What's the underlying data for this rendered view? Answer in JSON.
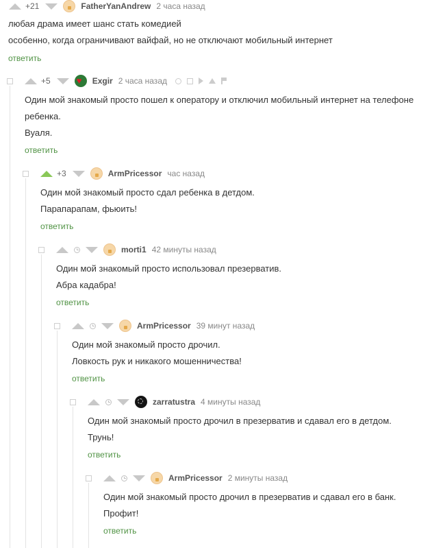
{
  "reply_label": "ответить",
  "comments": [
    {
      "score": "+21",
      "username": "FatherYanAndrew",
      "time": "2 часа назад",
      "avatar_icon": "doll-avatar",
      "lines": [
        "любая драма имеет шанс стать комедией",
        "особенно, когда ограничивают вайфай, но не отключают мобильный интернет"
      ]
    },
    {
      "score": "+5",
      "username": "Exgir",
      "time": "2 часа назад",
      "avatar_icon": "heart-avatar",
      "tool_icons": [
        "link-icon",
        "save-icon",
        "arrow-icon",
        "share-icon",
        "flag-icon"
      ],
      "lines": [
        "Один мой знакомый просто пошел к оператору и отключил мобильный интернет на телефоне",
        "ребенка.",
        "Вуаля."
      ]
    },
    {
      "score": "+3",
      "username": "ArmPricessor",
      "time": "час назад",
      "avatar_icon": "doll-avatar",
      "lines": [
        "Один мой знакомый просто сдал ребенка в детдом.",
        "Парапарапам, фьюить!"
      ]
    },
    {
      "username": "morti1",
      "time": "42 минуты назад",
      "avatar_icon": "doll-avatar",
      "lines": [
        "Один мой знакомый просто использовал презерватив.",
        "Абра кадабра!"
      ]
    },
    {
      "username": "ArmPricessor",
      "time": "39 минут назад",
      "avatar_icon": "doll-avatar",
      "lines": [
        "Один мой знакомый просто дрочил.",
        "Ловкость рук и никакого мошенничества!"
      ]
    },
    {
      "username": "zarratustra",
      "time": "4 минуты назад",
      "avatar_icon": "dark-avatar",
      "lines": [
        "Один мой знакомый просто дрочил в презерватив и сдавал его в детдом.",
        "Трунь!"
      ]
    },
    {
      "username": "ArmPricessor",
      "time": "2 минуты назад",
      "avatar_icon": "doll-avatar",
      "lines": [
        "Один мой знакомый просто дрочил в презерватив и сдавал его в банк.",
        "Профит!"
      ]
    }
  ]
}
